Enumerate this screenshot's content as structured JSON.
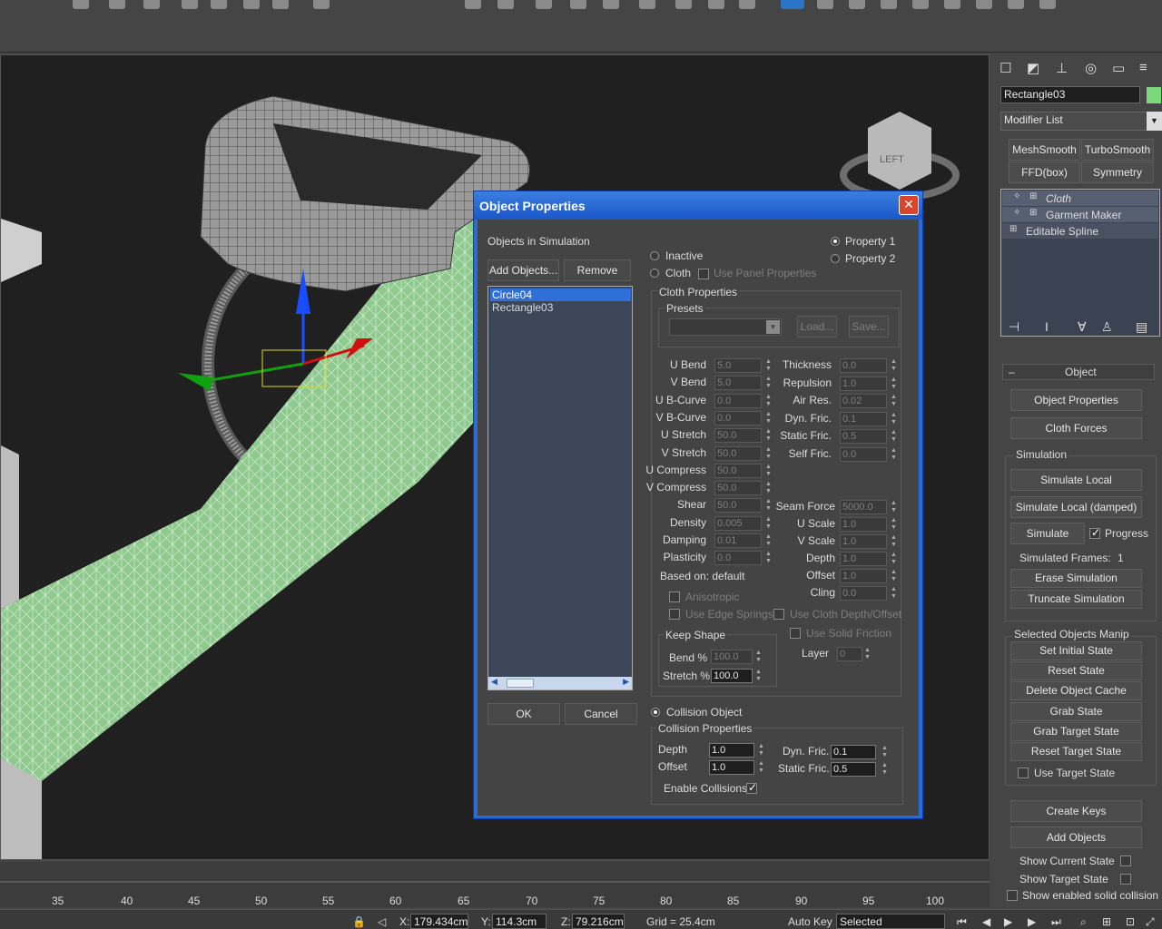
{
  "object_name": "Rectangle03",
  "modifier_list": "Modifier List",
  "modifier_buttons": [
    "MeshSmooth",
    "TurboSmooth",
    "FFD(box)",
    "Symmetry"
  ],
  "stack": [
    "Cloth",
    "Garment Maker",
    "Editable Spline"
  ],
  "viewcube_label": "LEFT",
  "rollout_object": "Object",
  "panel": {
    "object_properties": "Object Properties",
    "cloth_forces": "Cloth Forces",
    "simulation": "Simulation",
    "simulate_local": "Simulate Local",
    "simulate_local_damped": "Simulate Local (damped)",
    "simulate": "Simulate",
    "progress": "Progress",
    "simulated_frames_label": "Simulated Frames:",
    "simulated_frames_value": "1",
    "erase_simulation": "Erase Simulation",
    "truncate_simulation": "Truncate Simulation",
    "selected_objects_manip": "Selected Objects Manip",
    "set_initial_state": "Set Initial State",
    "reset_state": "Reset State",
    "delete_object_cache": "Delete Object Cache",
    "grab_state": "Grab State",
    "grab_target_state": "Grab Target State",
    "reset_target_state": "Reset Target State",
    "use_target_state": "Use Target State",
    "create_keys": "Create Keys",
    "add_objects": "Add Objects",
    "show_current_state": "Show Current State",
    "show_target_state": "Show Target State",
    "show_enabled_solid_collision": "Show enabled solid collision"
  },
  "timeline_ticks": [
    "35",
    "40",
    "45",
    "50",
    "55",
    "60",
    "65",
    "70",
    "75",
    "80",
    "85",
    "90",
    "95",
    "100"
  ],
  "status": {
    "x_label": "X:",
    "x_value": "179.434cm",
    "y_label": "Y:",
    "y_value": "114.3cm",
    "z_label": "Z:",
    "z_value": "79.216cm",
    "grid": "Grid = 25.4cm",
    "auto_key": "Auto Key",
    "selected": "Selected"
  },
  "dialog": {
    "title": "Object Properties",
    "objects_in_simulation": "Objects in Simulation",
    "add_objects": "Add Objects...",
    "remove": "Remove",
    "objects": [
      "Circle04",
      "Rectangle03"
    ],
    "ok": "OK",
    "cancel": "Cancel",
    "property1": "Property 1",
    "property2": "Property 2",
    "inactive": "Inactive",
    "cloth": "Cloth",
    "use_panel_properties": "Use Panel Properties",
    "cloth_properties": "Cloth Properties",
    "presets": "Presets",
    "load": "Load...",
    "save": "Save...",
    "left_params": [
      {
        "label": "U Bend",
        "value": "5.0"
      },
      {
        "label": "V Bend",
        "value": "5.0"
      },
      {
        "label": "U B-Curve",
        "value": "0.0"
      },
      {
        "label": "V B-Curve",
        "value": "0.0"
      },
      {
        "label": "U Stretch",
        "value": "50.0"
      },
      {
        "label": "V Stretch",
        "value": "50.0"
      },
      {
        "label": "U Compress",
        "value": "50.0"
      },
      {
        "label": "V Compress",
        "value": "50.0"
      },
      {
        "label": "Shear",
        "value": "50.0"
      },
      {
        "label": "Density",
        "value": "0.005"
      },
      {
        "label": "Damping",
        "value": "0.01"
      },
      {
        "label": "Plasticity",
        "value": "0.0"
      }
    ],
    "right_params_top": [
      {
        "label": "Thickness",
        "value": "0.0"
      },
      {
        "label": "Repulsion",
        "value": "1.0"
      },
      {
        "label": "Air Res.",
        "value": "0.02"
      },
      {
        "label": "Dyn. Fric.",
        "value": "0.1"
      },
      {
        "label": "Static Fric.",
        "value": "0.5"
      },
      {
        "label": "Self Fric.",
        "value": "0.0"
      }
    ],
    "right_params_bottom": [
      {
        "label": "Seam Force",
        "value": "5000.0"
      },
      {
        "label": "U Scale",
        "value": "1.0"
      },
      {
        "label": "V Scale",
        "value": "1.0"
      },
      {
        "label": "Depth",
        "value": "1.0"
      },
      {
        "label": "Offset",
        "value": "1.0"
      },
      {
        "label": "Cling",
        "value": "0.0"
      }
    ],
    "based_on": "Based on: default",
    "anisotropic": "Anisotropic",
    "use_edge_springs": "Use Edge Springs",
    "use_cloth_depth_offset": "Use Cloth Depth/Offset",
    "use_solid_friction": "Use Solid Friction",
    "layer_label": "Layer",
    "layer_value": "0",
    "keep_shape": "Keep Shape",
    "bend_pct_label": "Bend %",
    "bend_pct_value": "100.0",
    "stretch_pct_label": "Stretch %",
    "stretch_pct_value": "100.0",
    "collision_object": "Collision Object",
    "collision_properties": "Collision Properties",
    "c_depth_label": "Depth",
    "c_depth_value": "1.0",
    "c_offset_label": "Offset",
    "c_offset_value": "1.0",
    "c_dyn_fric_label": "Dyn. Fric.",
    "c_dyn_fric_value": "0.1",
    "c_static_fric_label": "Static Fric.",
    "c_static_fric_value": "0.5",
    "enable_collisions": "Enable Collisions"
  },
  "colors": {
    "dialog_title": "#2a6bd8",
    "cloth_green": "#8fc98f",
    "selection": "#2e6fd8"
  }
}
